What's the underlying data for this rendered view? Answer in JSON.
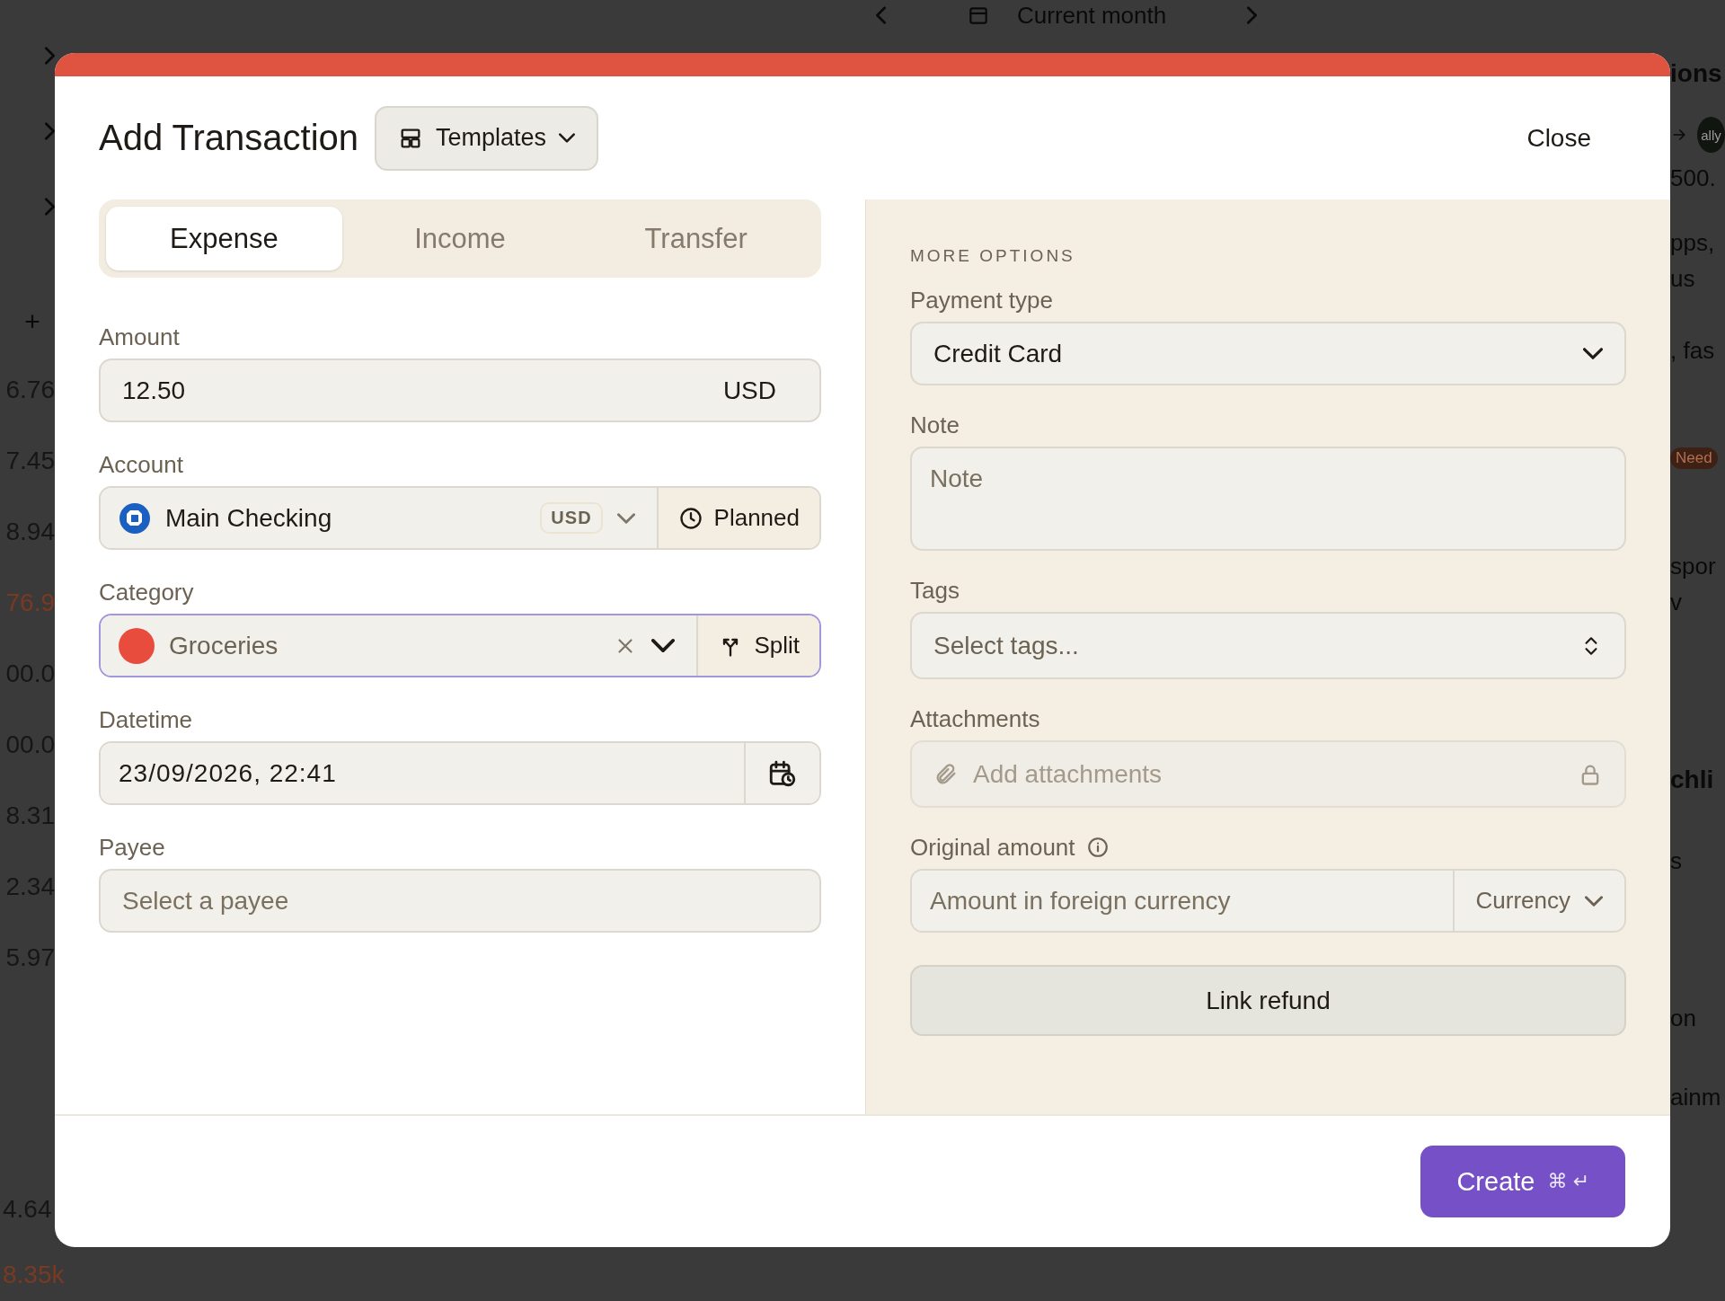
{
  "background": {
    "top_bar": {
      "title": "Current month"
    },
    "left_column": {
      "add_button": "+",
      "amounts": [
        {
          "text": "6.76",
          "color": "#161616"
        },
        {
          "text": "7.45",
          "color": "#161616"
        },
        {
          "text": "8.94",
          "color": "#161616"
        },
        {
          "text": "76.9",
          "color": "#7a3a22"
        },
        {
          "text": "00.0",
          "color": "#161616"
        },
        {
          "text": "00.0",
          "color": "#161616"
        },
        {
          "text": "8.31",
          "color": "#161616"
        },
        {
          "text": "2.34",
          "color": "#161616"
        },
        {
          "text": "5.97",
          "color": "#161616"
        }
      ],
      "footer_amounts": [
        {
          "text": "4.64",
          "color": "#161616"
        },
        {
          "text": "8.35k",
          "color": "#7a3a22"
        }
      ]
    },
    "right_column": [
      {
        "kind": "heading",
        "text": "ions"
      },
      {
        "kind": "avatar",
        "text": "ally"
      },
      {
        "kind": "text",
        "text": "500."
      },
      {
        "kind": "text",
        "text": "pps,"
      },
      {
        "kind": "text",
        "text": "us"
      },
      {
        "kind": "text",
        "text": ", fas"
      },
      {
        "kind": "badge",
        "text": "Need"
      },
      {
        "kind": "text",
        "text": "spor"
      },
      {
        "kind": "text",
        "text": "v"
      },
      {
        "kind": "heading",
        "text": "chli"
      },
      {
        "kind": "text",
        "text": "s"
      },
      {
        "kind": "text",
        "text": "on"
      },
      {
        "kind": "text",
        "text": "ainm"
      }
    ]
  },
  "dialog": {
    "title": "Add Transaction",
    "templates_button": "Templates",
    "close_button": "Close",
    "tabs": [
      {
        "label": "Expense",
        "selected": true
      },
      {
        "label": "Income",
        "selected": false
      },
      {
        "label": "Transfer",
        "selected": false
      }
    ],
    "amount": {
      "label": "Amount",
      "value": "12.50",
      "currency": "USD"
    },
    "account": {
      "label": "Account",
      "value": "Main Checking",
      "currency": "USD",
      "planned_button": "Planned"
    },
    "category": {
      "label": "Category",
      "value": "Groceries",
      "color": "#e84c3d",
      "focused": true,
      "split_button": "Split"
    },
    "datetime": {
      "label": "Datetime",
      "value": "23/09/2026, 22:41"
    },
    "payee": {
      "label": "Payee",
      "placeholder": "Select a payee"
    },
    "more_options": {
      "heading": "MORE OPTIONS",
      "payment_type": {
        "label": "Payment type",
        "value": "Credit Card"
      },
      "note": {
        "label": "Note",
        "placeholder": "Note"
      },
      "tags": {
        "label": "Tags",
        "placeholder": "Select tags..."
      },
      "attachments": {
        "label": "Attachments",
        "placeholder": "Add attachments",
        "disabled": true
      },
      "original_amount": {
        "label": "Original amount",
        "placeholder": "Amount in foreign currency",
        "currency": "Currency"
      },
      "link_refund_button": "Link refund"
    },
    "create_button": {
      "label": "Create",
      "shortcut": "⌘ ↵"
    }
  }
}
